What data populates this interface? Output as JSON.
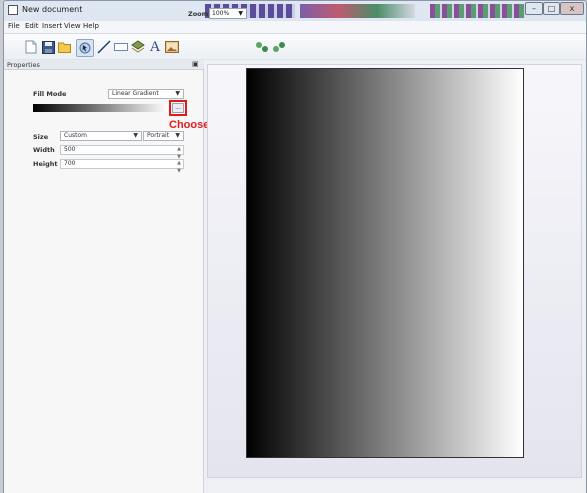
{
  "window": {
    "title": "New document",
    "controls": {
      "minimize": "–",
      "maximize": "□",
      "close": "x"
    }
  },
  "menu": [
    "File",
    "Edit",
    "Insert",
    "View",
    "Help"
  ],
  "toolbar": {
    "tools": [
      "new-icon",
      "save-icon",
      "open-icon",
      "select-tool-icon",
      "line-tool-icon",
      "rectangle-tool-icon",
      "shape-tool-icon",
      "text-tool-icon",
      "image-tool-icon"
    ],
    "active_tool": "select-tool-icon",
    "zoom_label": "Zoom",
    "zoom_value": "100%",
    "extras": [
      "zoom-in-icon",
      "zoom-out-icon"
    ]
  },
  "properties": {
    "title": "Properties",
    "fill_mode_label": "Fill Mode",
    "fill_mode_value": "Linear Gradient",
    "choose_button_label": "...",
    "size_label": "Size",
    "size_value": "Custom",
    "orientation_value": "Portrait",
    "width_label": "Width",
    "width_value": "500",
    "height_label": "Height",
    "height_value": "700"
  },
  "annotation": {
    "text": "Choose Button",
    "color": "#e11b1b"
  },
  "colors": {
    "gradient_start": "#000000",
    "gradient_end": "#ffffff",
    "accent": "#e11b1b"
  }
}
